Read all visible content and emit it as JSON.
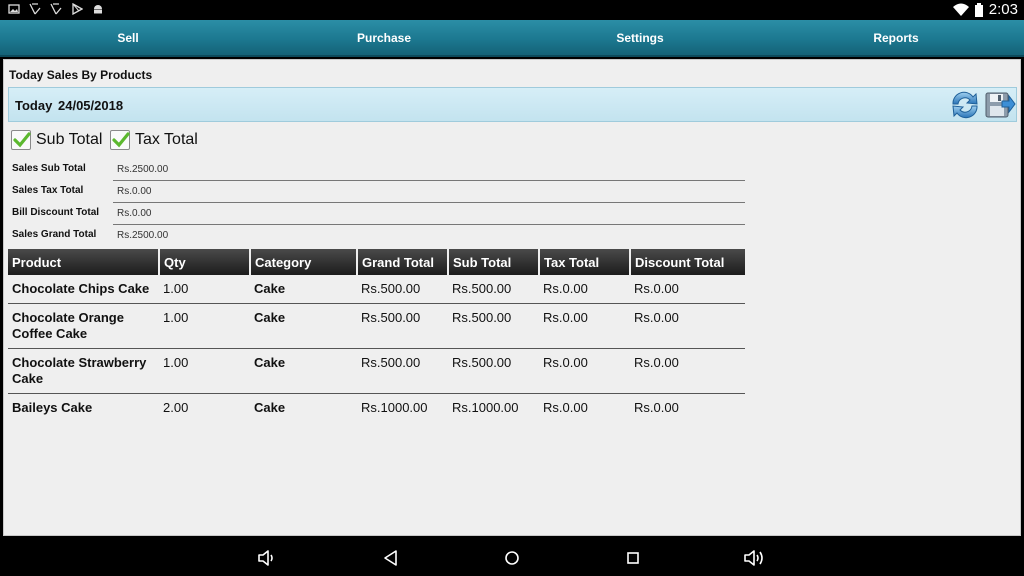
{
  "status_bar": {
    "time": "2:03",
    "left_icons": [
      "image-icon",
      "signal-off-icon",
      "signal-off-icon",
      "play-store-icon",
      "android-icon"
    ],
    "right_icons": [
      "wifi-icon",
      "battery-icon"
    ]
  },
  "tabs": [
    {
      "label": "Sell"
    },
    {
      "label": "Purchase"
    },
    {
      "label": "Settings"
    },
    {
      "label": "Reports"
    }
  ],
  "page": {
    "title": "Today Sales By Products",
    "date_label": "Today",
    "date_value": "24/05/2018"
  },
  "toolbar": {
    "refresh_icon": "refresh-icon",
    "save_icon": "save-export-icon"
  },
  "checkboxes": [
    {
      "label": "Sub Total",
      "checked": true
    },
    {
      "label": "Tax Total",
      "checked": true
    }
  ],
  "summary": [
    {
      "label": "Sales Sub Total",
      "value": "Rs.2500.00"
    },
    {
      "label": "Sales Tax Total",
      "value": "Rs.0.00"
    },
    {
      "label": "Bill Discount Total",
      "value": "Rs.0.00"
    },
    {
      "label": "Sales Grand Total",
      "value": "Rs.2500.00"
    }
  ],
  "table": {
    "columns": [
      "Product",
      "Qty",
      "Category",
      "Grand Total",
      "Sub Total",
      "Tax Total",
      "Discount Total"
    ],
    "rows": [
      [
        "Chocolate Chips Cake",
        "1.00",
        "Cake",
        "Rs.500.00",
        "Rs.500.00",
        "Rs.0.00",
        "Rs.0.00"
      ],
      [
        "Chocolate Orange Coffee Cake",
        "1.00",
        "Cake",
        "Rs.500.00",
        "Rs.500.00",
        "Rs.0.00",
        "Rs.0.00"
      ],
      [
        "Chocolate Strawberry Cake",
        "1.00",
        "Cake",
        "Rs.500.00",
        "Rs.500.00",
        "Rs.0.00",
        "Rs.0.00"
      ],
      [
        "Baileys Cake",
        "2.00",
        "Cake",
        "Rs.1000.00",
        "Rs.1000.00",
        "Rs.0.00",
        "Rs.0.00"
      ]
    ]
  },
  "nav_bar": {
    "icons": [
      "volume-down-icon",
      "back-icon",
      "home-icon",
      "recents-icon",
      "volume-up-icon"
    ]
  },
  "colors": {
    "tab_bar": "#1c7890",
    "date_bar": "#c3e3ef",
    "content_bg": "#efefef",
    "check_green": "#5cb82e"
  }
}
